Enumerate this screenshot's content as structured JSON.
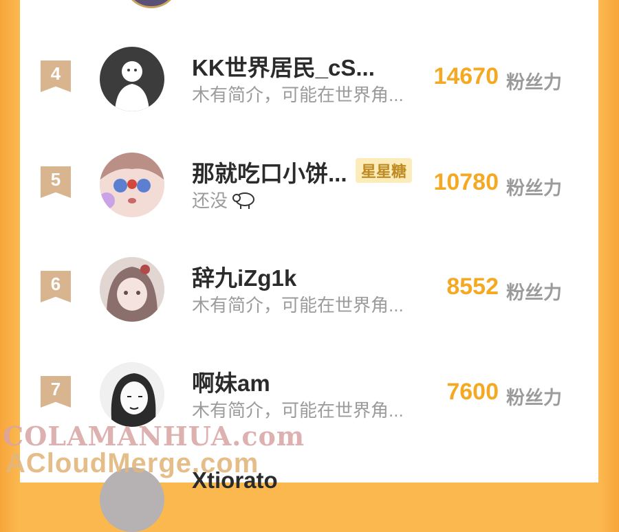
{
  "unit_label": "粉丝力",
  "rows": [
    {
      "rank": "4",
      "name": "KK世界居民_cS...",
      "bio": "木有简介，可能在世界角...",
      "badge": "",
      "score": "14670"
    },
    {
      "rank": "5",
      "name": "那就吃口小饼...",
      "bio": "还没",
      "badge": "星星糖",
      "score": "10780"
    },
    {
      "rank": "6",
      "name": "辞九iZg1k",
      "bio": "木有简介，可能在世界角...",
      "badge": "",
      "score": "8552"
    },
    {
      "rank": "7",
      "name": "啊妹am",
      "bio": "木有简介，可能在世界角...",
      "badge": "",
      "score": "7600"
    }
  ],
  "next_row_name": "Xtiorato",
  "watermarks": [
    "COLAMANHUA.com",
    "ACloudMerge.com"
  ],
  "colors": {
    "accent": "#f5a923",
    "rank_bg": "#d8b58f",
    "badge_bg": "#fbecb9"
  }
}
